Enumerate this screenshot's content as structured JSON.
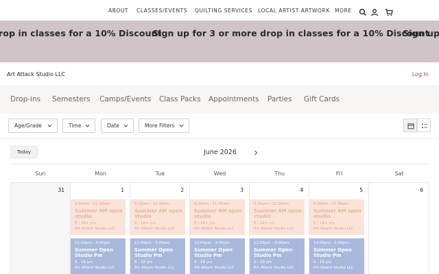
{
  "topnav": {
    "links": [
      "ABOUT",
      "CLASSES/EVENTS",
      "QUILTING SERVICES",
      "LOCAL ARTIST ARTWORK",
      "MORE"
    ],
    "icons": [
      "search-icon",
      "account-icon",
      "cart-icon"
    ]
  },
  "banner": {
    "message_1": "rop in classes for a 10% Discount",
    "message_2": "Sign up for 3 or more drop in classes for a 10% Discount",
    "message_3": "Sign up",
    "background": "#d1c4c8"
  },
  "studio": {
    "name": "Art Attack Studio LLC",
    "login": "Log In"
  },
  "tabs": [
    "Drop-ins",
    "Semesters",
    "Camps/Events",
    "Class Packs",
    "Appointments",
    "Parties",
    "Gift Cards"
  ],
  "filters": [
    "Age/Grade",
    "Time",
    "Date",
    "More Filters"
  ],
  "view_toggle": [
    "calendar-view",
    "list-view"
  ],
  "calendar": {
    "today_label": "Today",
    "month_label": "June 2026",
    "weekdays": [
      "Sun",
      "Mon",
      "Tue",
      "Wed",
      "Thu",
      "Fri",
      "Sat"
    ],
    "days": [
      {
        "num": "31",
        "other_month": true,
        "events": []
      },
      {
        "num": "1",
        "other_month": false,
        "events": [
          {
            "time": "9:30am - 11:30am",
            "title": "Summer AM open studio",
            "age": "6 - 18+ yrs",
            "org": "Art Attack Studio LLC",
            "kind": "am"
          },
          {
            "time": "12:00pm - 3:00pm",
            "title": "Summer Open Studio Pm",
            "age": "6 - 16 yrs",
            "org": "Art Attack Studio LLC",
            "kind": "pm"
          }
        ]
      },
      {
        "num": "2",
        "other_month": false,
        "events": [
          {
            "time": "9:30am - 11:30am",
            "title": "Summer AM open studio",
            "age": "6 - 18+ yrs",
            "org": "Art Attack Studio LLC",
            "kind": "am"
          },
          {
            "time": "12:00pm - 3:00pm",
            "title": "Summer Open Studio Pm",
            "age": "6 - 16 yrs",
            "org": "Art Attack Studio LLC",
            "kind": "pm"
          }
        ]
      },
      {
        "num": "3",
        "other_month": false,
        "events": [
          {
            "time": "9:30am - 11:30am",
            "title": "Summer AM open studio",
            "age": "6 - 18+ yrs",
            "org": "Art Attack Studio LLC",
            "kind": "am"
          },
          {
            "time": "12:00pm - 3:00pm",
            "title": "Summer Open Studio Pm",
            "age": "6 - 16 yrs",
            "org": "Art Attack Studio LLC",
            "kind": "pm"
          }
        ]
      },
      {
        "num": "4",
        "other_month": false,
        "events": [
          {
            "time": "9:30am - 11:30am",
            "title": "Summer AM open studio",
            "age": "6 - 18+ yrs",
            "org": "Art Attack Studio LLC",
            "kind": "am"
          },
          {
            "time": "12:00pm - 3:00pm",
            "title": "Summer Open Studio Pm",
            "age": "6 - 16 yrs",
            "org": "Art Attack Studio LLC",
            "kind": "pm"
          }
        ]
      },
      {
        "num": "5",
        "other_month": false,
        "events": [
          {
            "time": "9:30am - 11:30am",
            "title": "Summer AM open studio",
            "age": "6 - 18+ yrs",
            "org": "Art Attack Studio LLC",
            "kind": "am"
          },
          {
            "time": "12:00pm - 3:00pm",
            "title": "Summer Open Studio Pm",
            "age": "6 - 16 yrs",
            "org": "Art Attack Studio LLC",
            "kind": "pm"
          }
        ]
      },
      {
        "num": "6",
        "other_month": false,
        "events": []
      }
    ]
  },
  "colors": {
    "login": "#c0392b",
    "am_event_bg": "#fbe3d8",
    "pm_event_bg": "#a8b9dd"
  }
}
